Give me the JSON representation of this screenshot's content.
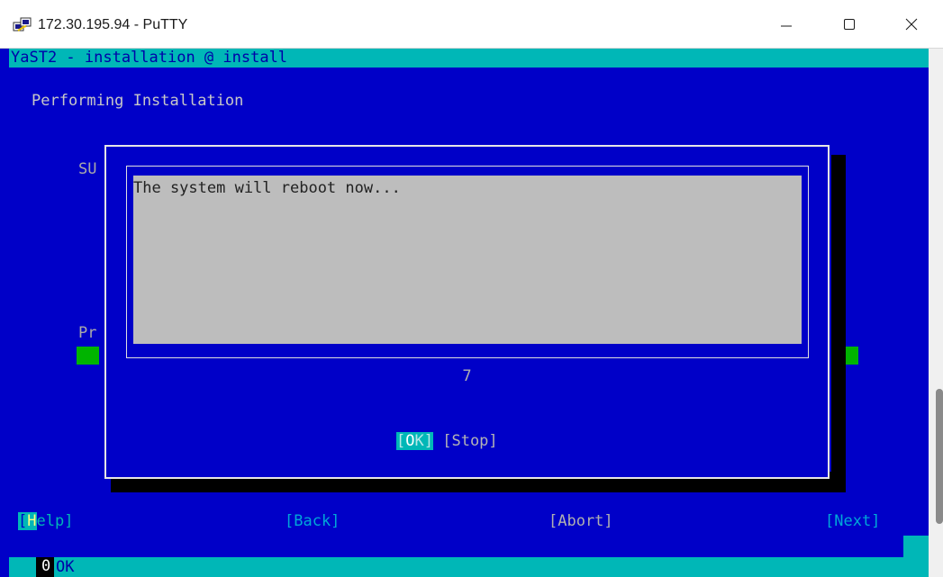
{
  "window": {
    "title": "172.30.195.94 - PuTTY",
    "icon": "putty-icon",
    "controls": {
      "minimize": "minimize-icon",
      "maximize": "maximize-icon",
      "close": "close-icon"
    }
  },
  "terminal": {
    "header": "YaST2 - installation @ install",
    "heading": "Performing Installation",
    "background_fragments": {
      "su": "SU",
      "pr": "Pr"
    },
    "dialog": {
      "message": "The system will reboot now...",
      "countdown": "7",
      "ok_button": {
        "open": "[",
        "hotkey": "O",
        "rest": "K]"
      },
      "stop_button": "[Stop]"
    },
    "buttons": {
      "help": {
        "open": "[",
        "hotkey": "H",
        "rest": "elp]"
      },
      "back": "[Back]",
      "abort": "[Abort]",
      "next": "[Next]"
    },
    "status": {
      "code": "0",
      "text": "OK"
    }
  },
  "colors": {
    "terminal_bg": "#0000c8",
    "cyan": "#00b7b7",
    "dialog_message_bg": "#bdbdbd",
    "green": "#00b400"
  }
}
